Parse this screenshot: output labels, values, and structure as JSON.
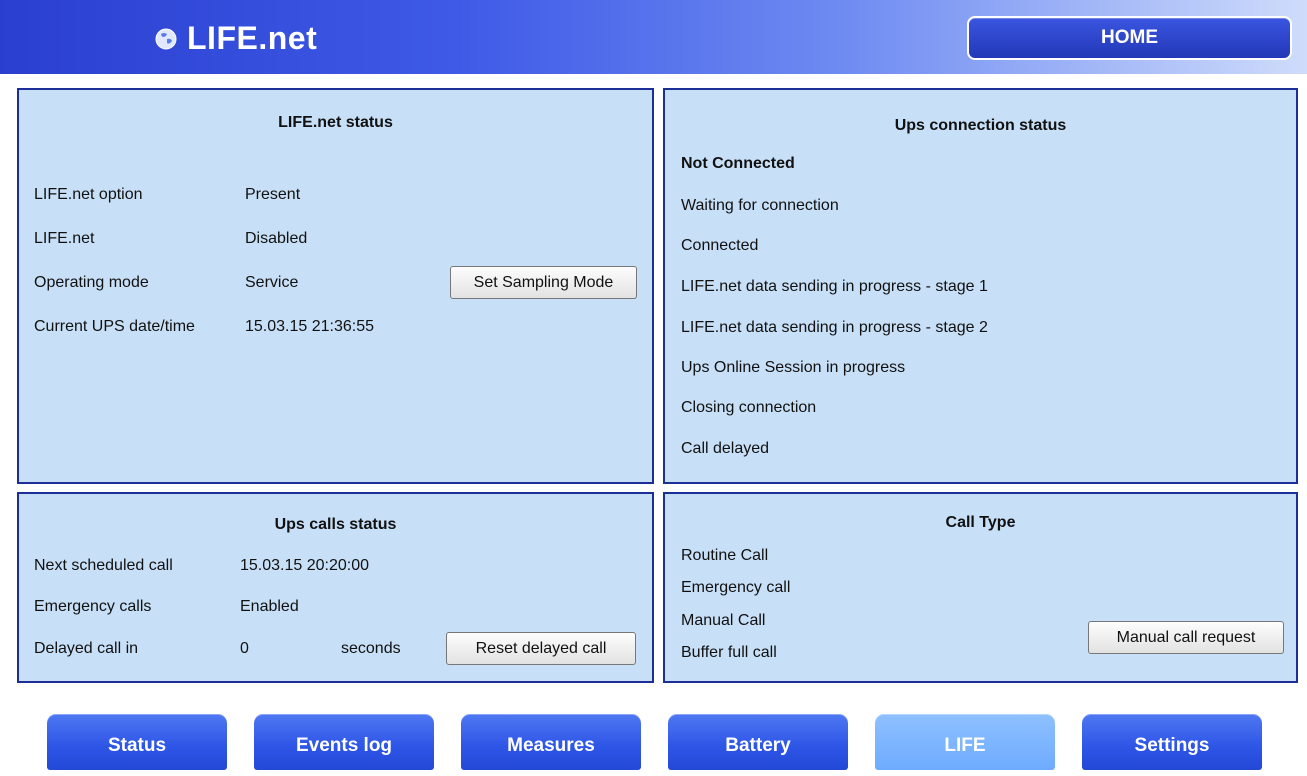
{
  "header": {
    "logo_text": "LIFE.net",
    "home_label": "HOME"
  },
  "life_status": {
    "title": "LIFE.net status",
    "rows": [
      {
        "label": "LIFE.net option",
        "value": "Present"
      },
      {
        "label": "LIFE.net",
        "value": "Disabled"
      },
      {
        "label": "Operating mode",
        "value": "Service"
      },
      {
        "label": "Current UPS date/time",
        "value": "15.03.15 21:36:55"
      }
    ],
    "sampling_button": "Set Sampling Mode"
  },
  "connection_status": {
    "title": "Ups connection status",
    "items": [
      "Not Connected",
      "Waiting for connection",
      "Connected",
      "LIFE.net data sending in progress - stage 1",
      "LIFE.net data sending in progress - stage 2",
      "Ups Online Session in progress",
      "Closing connection",
      "Call delayed"
    ]
  },
  "calls_status": {
    "title": "Ups calls status",
    "rows": [
      {
        "label": "Next scheduled call",
        "value": "15.03.15 20:20:00"
      },
      {
        "label": "Emergency calls",
        "value": "Enabled"
      },
      {
        "label": "Delayed call in",
        "value": "0"
      }
    ],
    "seconds_unit": "seconds",
    "reset_button": "Reset delayed call"
  },
  "call_type": {
    "title": "Call Type",
    "items": [
      "Routine Call",
      "Emergency call",
      "Manual Call",
      "Buffer full call"
    ],
    "manual_button": "Manual call request"
  },
  "nav": {
    "items": [
      "Status",
      "Events log",
      "Measures",
      "Battery",
      "LIFE",
      "Settings"
    ],
    "active": "LIFE"
  }
}
